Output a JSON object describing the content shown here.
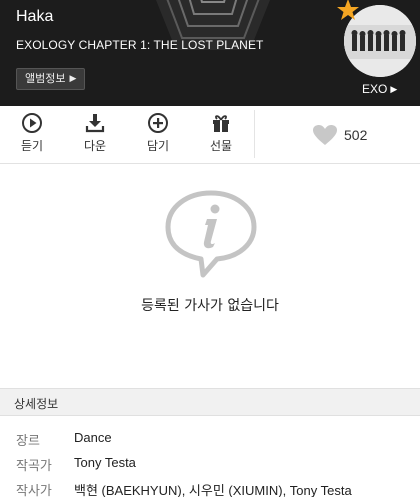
{
  "header": {
    "song_title": "Haka",
    "album_name": "EXOLOGY CHAPTER 1: THE LOST PLANET",
    "album_info_label": "앨범정보",
    "artist_label": "EXO",
    "bg_color": "#1c1c1c",
    "star_color": "#f5a623"
  },
  "actions": {
    "items": [
      {
        "label": "듣기",
        "icon": "play-icon"
      },
      {
        "label": "다운",
        "icon": "download-icon"
      },
      {
        "label": "담기",
        "icon": "add-icon"
      },
      {
        "label": "선물",
        "icon": "gift-icon"
      }
    ],
    "like_count": "502"
  },
  "lyrics": {
    "empty_message": "등록된 가사가 없습니다"
  },
  "details": {
    "section_title": "상세정보",
    "rows": [
      {
        "key": "장르",
        "value": "Dance"
      },
      {
        "key": "작곡가",
        "value": "Tony Testa"
      },
      {
        "key": "작사가",
        "value": "백현 (BAEKHYUN), 시우민 (XIUMIN), Tony Testa"
      }
    ]
  }
}
